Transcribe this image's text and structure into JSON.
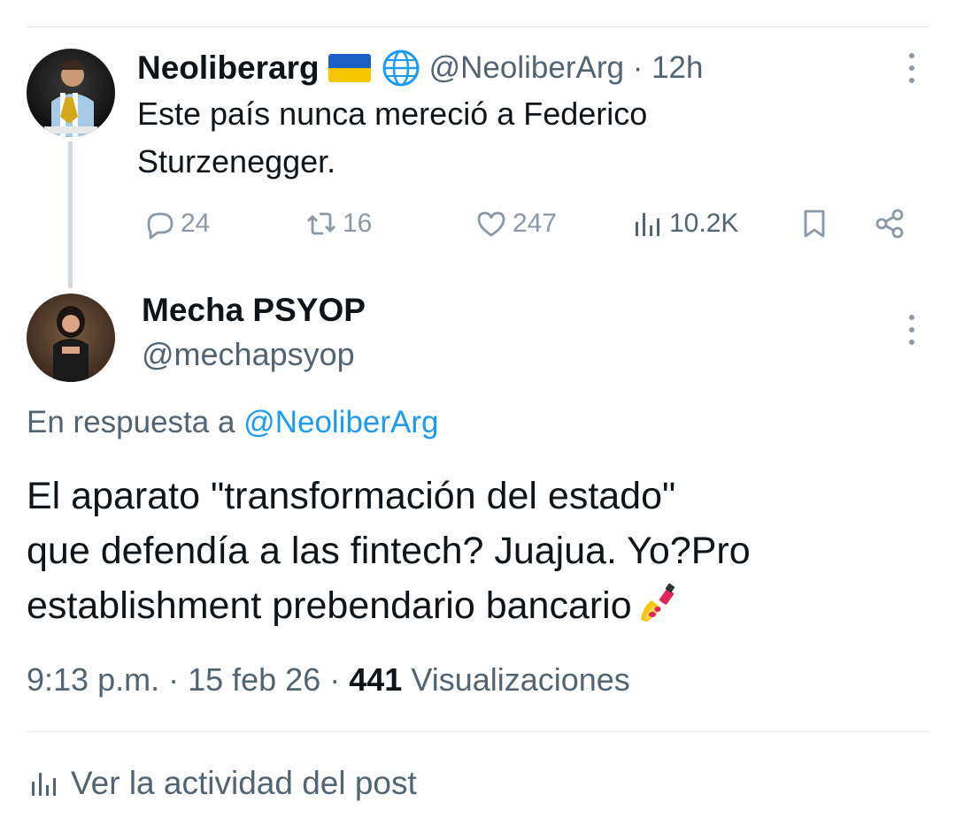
{
  "parent_tweet": {
    "display_name": "Neoliberarg",
    "flag_icon": "ukraine-flag-icon",
    "globe_icon": "globe-icon",
    "handle": "@NeoliberArg",
    "time": "12h",
    "text": "Este país nunca mereció a Federico\nSturzenegger.",
    "actions": {
      "replies": "24",
      "reposts": "16",
      "likes": "247",
      "views": "10.2K"
    }
  },
  "reply_tweet": {
    "display_name": "Mecha PSYOP",
    "handle": "@mechapsyop",
    "replying_prefix": "En respuesta a",
    "replying_to": "@NeoliberArg",
    "text": "El aparato \"transformación del estado\"\nque defendía a las fintech? Juajua. Yo?Pro\nestablishment prebendario bancario",
    "emoji_icon": "nail-polish-emoji",
    "time": "9:13 p.m.",
    "date": "15 feb 26",
    "views_count": "441",
    "views_label": "Visualizaciones"
  },
  "activity_link": "Ver la actividad del post",
  "colors": {
    "accent": "#1d9bf0",
    "text_primary": "#0f1419",
    "text_secondary": "#536471",
    "icon_gray": "#8b98a5"
  }
}
